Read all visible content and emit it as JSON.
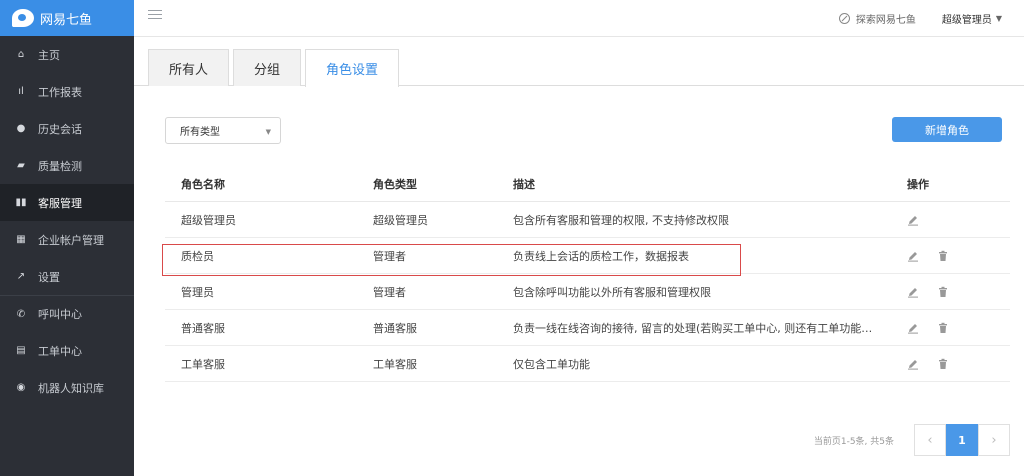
{
  "app": {
    "logo_text": "网易七鱼"
  },
  "sidebar": {
    "items": [
      {
        "label": "主页",
        "icon": "home-icon",
        "glyph": "⌂"
      },
      {
        "label": "工作报表",
        "icon": "bar-chart-icon",
        "glyph": "ıl"
      },
      {
        "label": "历史会话",
        "icon": "clock-icon",
        "glyph": "●"
      },
      {
        "label": "质量检测",
        "icon": "car-icon",
        "glyph": "▰"
      },
      {
        "label": "客服管理",
        "icon": "org-icon",
        "glyph": "▮▮"
      },
      {
        "label": "企业帐户管理",
        "icon": "building-icon",
        "glyph": "▦"
      },
      {
        "label": "设置",
        "icon": "wrench-icon",
        "glyph": "↗"
      },
      {
        "label": "呼叫中心",
        "icon": "phone-icon",
        "glyph": "✆"
      },
      {
        "label": "工单中心",
        "icon": "ticket-icon",
        "glyph": "▤"
      },
      {
        "label": "机器人知识库",
        "icon": "robot-icon",
        "glyph": "◉"
      }
    ]
  },
  "topbar": {
    "explore": "探索网易七鱼",
    "user": "超级管理员"
  },
  "tabs": [
    "所有人",
    "分组",
    "角色设置"
  ],
  "toolbar": {
    "type_select": "所有类型",
    "add_button": "新增角色"
  },
  "table": {
    "headers": [
      "角色名称",
      "角色类型",
      "描述",
      "操作"
    ],
    "rows": [
      {
        "name": "超级管理员",
        "type": "超级管理员",
        "desc": "包含所有客服和管理的权限, 不支持修改权限",
        "deletable": false
      },
      {
        "name": "质检员",
        "type": "管理者",
        "desc": "负责线上会话的质检工作，数据报表",
        "deletable": true
      },
      {
        "name": "管理员",
        "type": "管理者",
        "desc": "包含除呼叫功能以外所有客服和管理权限",
        "deletable": true
      },
      {
        "name": "普通客服",
        "type": "普通客服",
        "desc": "负责一线在线咨询的接待, 留言的处理(若购买工单中心, 则还有工单功能…",
        "deletable": true
      },
      {
        "name": "工单客服",
        "type": "工单客服",
        "desc": "仅包含工单功能",
        "deletable": true
      }
    ]
  },
  "pagination": {
    "info": "当前页1-5条, 共5条",
    "current": "1",
    "prev": "‹",
    "next": "›"
  },
  "colors": {
    "accent": "#4a98e8",
    "sidebar_bg": "#2c2f36",
    "highlight": "#d94a4a"
  }
}
